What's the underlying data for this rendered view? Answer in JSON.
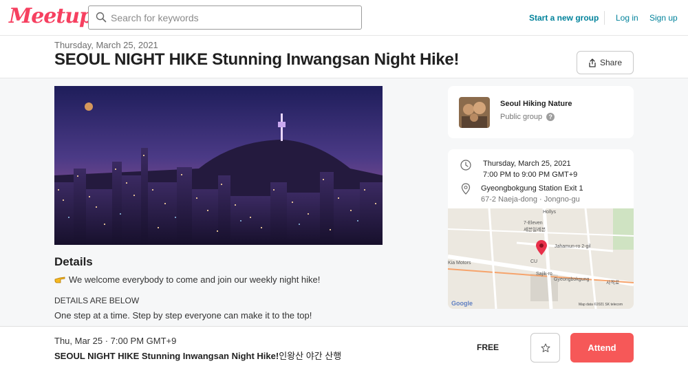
{
  "nav": {
    "logo_text": "Meetup",
    "search_placeholder": "Search for keywords",
    "start_group": "Start a new group",
    "login": "Log in",
    "signup": "Sign up"
  },
  "event": {
    "date_line": "Thursday, March 25, 2021",
    "title": "SEOUL NIGHT HIKE Stunning Inwangsan Night Hike!",
    "share_label": "Share"
  },
  "details": {
    "heading": "Details",
    "line1": "We welcome everybody to come and join our weekly night hike!",
    "line2": "DETAILS ARE BELOW",
    "line3": "One step at a time. Step by step everyone can make it to the top!"
  },
  "group": {
    "name": "Seoul Hiking Nature",
    "type": "Public group"
  },
  "info": {
    "date": "Thursday, March 25, 2021",
    "time": "7:00 PM to 9:00 PM GMT+9",
    "location": "Gyeongbokgung Station Exit 1",
    "address": "67-2 Naeja-dong · Jongno-gu"
  },
  "map": {
    "labels": [
      "Hollys",
      "7-Eleven",
      "세븐일레븐",
      "CU",
      "Jahamun-ro 2-gil",
      "Kia Motors",
      "Sajik-ro",
      "Gyeongbokgung",
      "사직로",
      "Google",
      "Map data ©2021 SK telecom"
    ]
  },
  "bottom": {
    "date": "Thu, Mar 25 · 7:00 PM GMT+9",
    "title": "SEOUL NIGHT HIKE Stunning Inwangsan Night Hike!",
    "title_kr": "인왕산 야간 산행",
    "price": "FREE",
    "attend": "Attend"
  },
  "colors": {
    "brand": "#f64060",
    "link": "#00829b",
    "attend_bg": "#f65858"
  }
}
